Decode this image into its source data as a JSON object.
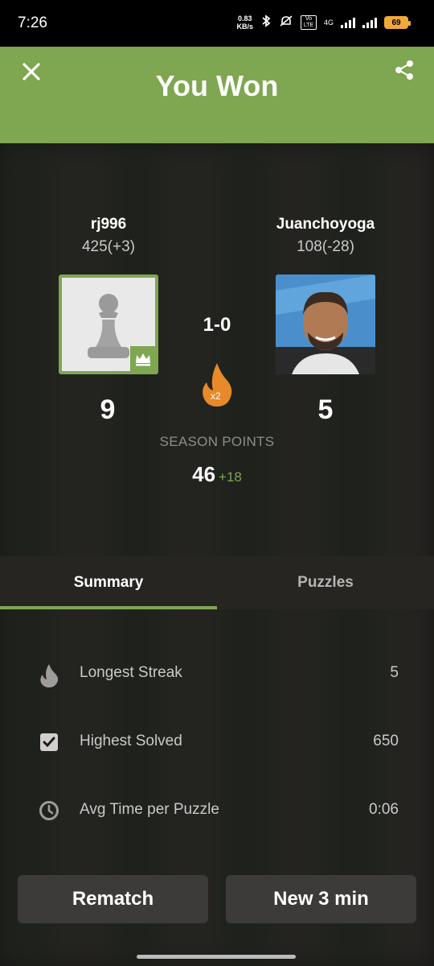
{
  "status_bar": {
    "time": "7:26",
    "net_speed_value": "0.83",
    "net_speed_unit": "KB/s",
    "network_type": "4G",
    "volte_label": "Vo LTE",
    "battery_level": "69"
  },
  "header": {
    "title": "You Won"
  },
  "players": {
    "left": {
      "username": "rj996",
      "rating": "425(+3)",
      "score": "9"
    },
    "right": {
      "username": "Juanchoyoga",
      "rating": "108(-28)",
      "score": "5"
    }
  },
  "result": "1-0",
  "multiplier": "x2",
  "season": {
    "label": "SEASON POINTS",
    "points": "46",
    "delta": "+18"
  },
  "tabs": [
    {
      "label": "Summary",
      "active": true
    },
    {
      "label": "Puzzles",
      "active": false
    }
  ],
  "stats": [
    {
      "icon": "flame-icon",
      "label": "Longest Streak",
      "value": "5"
    },
    {
      "icon": "checkbox-icon",
      "label": "Highest Solved",
      "value": "650"
    },
    {
      "icon": "clock-icon",
      "label": "Avg Time per Puzzle",
      "value": "0:06"
    }
  ],
  "buttons": {
    "rematch": "Rematch",
    "new_game": "New 3 min"
  },
  "colors": {
    "accent": "#7fa650",
    "flame": "#e8892a",
    "background": "#1c1b19",
    "button": "#3c3b39"
  }
}
